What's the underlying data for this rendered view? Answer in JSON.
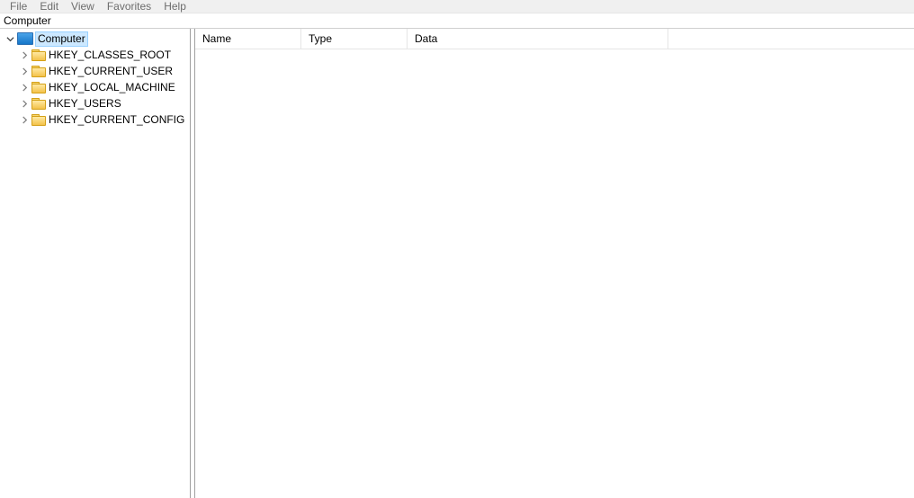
{
  "menubar": {
    "items": [
      "File",
      "Edit",
      "View",
      "Favorites",
      "Help"
    ]
  },
  "addressbar": {
    "path": "Computer"
  },
  "tree": {
    "root": {
      "label": "Computer",
      "expanded": true,
      "selected": true,
      "icon": "computer-icon"
    },
    "hives": [
      {
        "label": "HKEY_CLASSES_ROOT"
      },
      {
        "label": "HKEY_CURRENT_USER"
      },
      {
        "label": "HKEY_LOCAL_MACHINE"
      },
      {
        "label": "HKEY_USERS"
      },
      {
        "label": "HKEY_CURRENT_CONFIG"
      }
    ]
  },
  "list": {
    "columns": {
      "name": "Name",
      "type": "Type",
      "data": "Data"
    },
    "rows": []
  }
}
